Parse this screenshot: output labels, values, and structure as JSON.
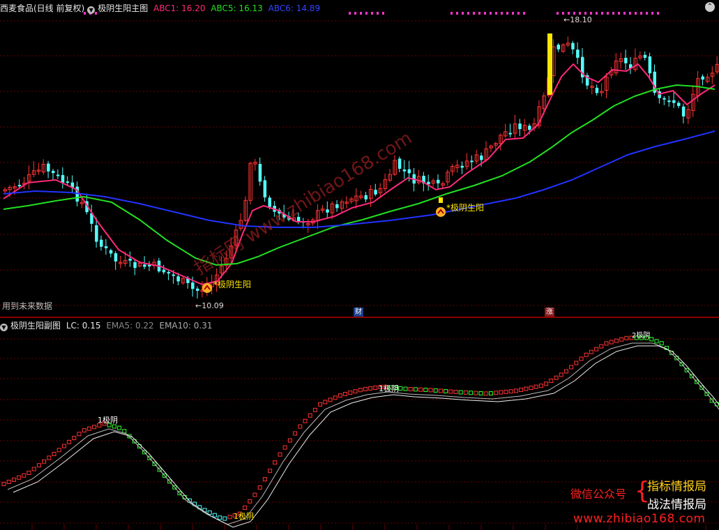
{
  "main": {
    "stock_name": "西麦食品(日线 前复权)",
    "indicator_name": "极阴生阳主图",
    "abc1": "ABC1: 16.20",
    "abc5": "ABC5: 16.13",
    "abc6": "ABC6: 14.89",
    "high_label": "18.10",
    "low_label": "10.09",
    "signal_label": "极阴生阳",
    "future_data_note": "用到未来数据",
    "badge_cai": "财",
    "badge_zhang": "涨",
    "colors": {
      "abc1": "#ff2a7a",
      "abc5": "#22e022",
      "abc6": "#2233ff",
      "up": "#ff3333",
      "down": "#54ffff"
    }
  },
  "sub": {
    "indicator_name": "极阴生阳副图",
    "lc": "LC: 0.15",
    "ema5": "EMA5: 0.22",
    "ema10": "EMA10: 0.31",
    "peak_label": "1极阴",
    "trough_label": "1极阴",
    "top_label": "2极阴"
  },
  "watermark": {
    "diag": "指标网 www.zhibiao168.com",
    "wechat": "微信公众号",
    "brand1": "指标情报局",
    "brand2": "战法情报局",
    "url": "www.zhibiao168.com"
  }
}
